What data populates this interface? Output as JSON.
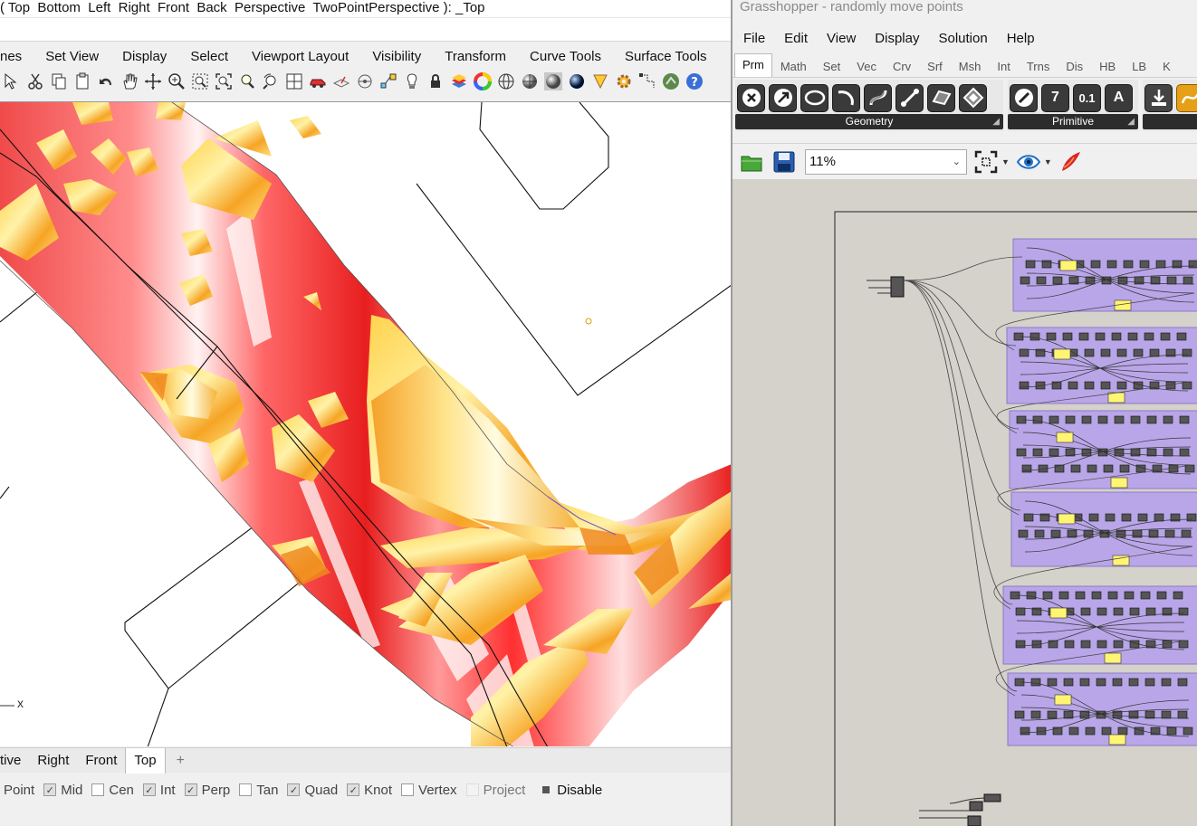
{
  "rhino": {
    "command_line": "( Top  Bottom  Left  Right  Front  Back  Perspective  TwoPointPerspective ): _Top",
    "menu_tabs": [
      "nes",
      "Set View",
      "Display",
      "Select",
      "Viewport Layout",
      "Visibility",
      "Transform",
      "Curve Tools",
      "Surface Tools"
    ],
    "toolbar_icons": [
      "select-icon",
      "cut-icon",
      "copy-icon",
      "paste-icon",
      "undo-icon",
      "pan-hand-icon",
      "rotate-view-icon",
      "zoom-dynamic-icon",
      "zoom-window-icon",
      "zoom-extents-icon",
      "zoom-selected-icon",
      "undo-view-icon",
      "four-viewports-icon",
      "named-views-car-icon",
      "set-cplane-icon",
      "cplane-origin-icon",
      "object-snap-icon",
      "light-icon",
      "lock-icon",
      "layers-icon",
      "color-wheel-icon",
      "wireframe-sphere-icon",
      "shaded-sphere-icon",
      "rendered-sphere-icon",
      "rendered-blue-sphere-icon",
      "render-icon",
      "gear-settings-icon",
      "transform-icon",
      "grasshopper-icon",
      "help-icon"
    ],
    "axis_label": "x",
    "viewport_tabs": [
      "tive",
      "Right",
      "Front",
      "Top"
    ],
    "active_viewport": "Top",
    "osnaps": [
      {
        "label": "Point",
        "state": "none"
      },
      {
        "label": "Mid",
        "state": "checked"
      },
      {
        "label": "Cen",
        "state": "unchecked"
      },
      {
        "label": "Int",
        "state": "checked"
      },
      {
        "label": "Perp",
        "state": "checked"
      },
      {
        "label": "Tan",
        "state": "unchecked"
      },
      {
        "label": "Quad",
        "state": "checked"
      },
      {
        "label": "Knot",
        "state": "checked"
      },
      {
        "label": "Vertex",
        "state": "unchecked"
      },
      {
        "label": "Project",
        "state": "disabled"
      },
      {
        "label": "Disable",
        "state": "filled"
      }
    ]
  },
  "grasshopper": {
    "title": "Grasshopper - randomly move points",
    "menu": [
      "File",
      "Edit",
      "View",
      "Display",
      "Solution",
      "Help"
    ],
    "tabs": [
      "Prm",
      "Math",
      "Set",
      "Vec",
      "Crv",
      "Srf",
      "Msh",
      "Int",
      "Trns",
      "Dis",
      "HB",
      "LB",
      "K"
    ],
    "active_tab": "Prm",
    "ribbon_groups": [
      {
        "label": "Geometry",
        "buttons": [
          "close-x-icon",
          "arrow-param-icon",
          "circle-param-icon",
          "arc-param-icon",
          "curve-param-icon",
          "line-param-icon",
          "surface-param-icon",
          "brep-param-icon"
        ]
      },
      {
        "label": "Primitive",
        "buttons": [
          "boolean-param-icon",
          "integer-param-icon",
          "number-param-icon",
          "text-param-icon"
        ]
      }
    ],
    "primitive_button_text": [
      "7",
      "0.1",
      "A"
    ],
    "zoom": "11%",
    "accent": {
      "group_fill": "#b9a6e8",
      "panel_yellow": "#fff572",
      "canvas": "#d5d1cb"
    }
  }
}
